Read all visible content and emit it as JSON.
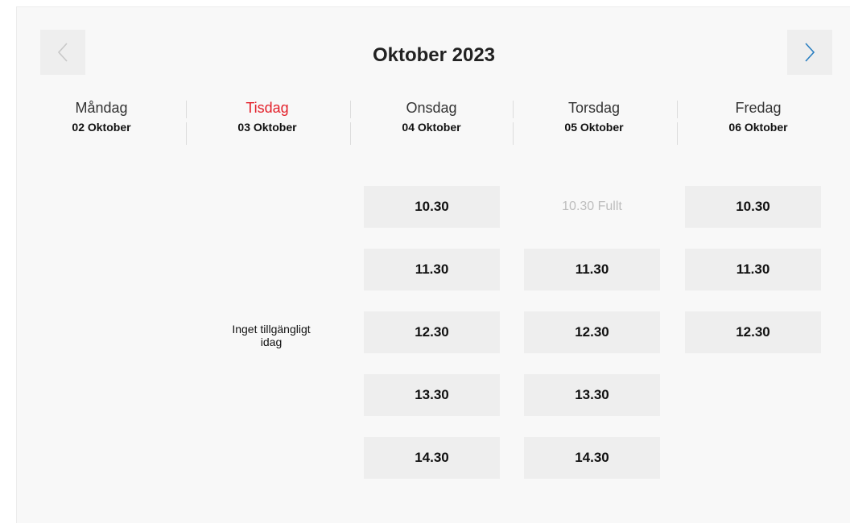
{
  "calendar": {
    "month_title": "Oktober 2023",
    "days": [
      {
        "name": "Måndag",
        "date": "02 Oktober",
        "today": false
      },
      {
        "name": "Tisdag",
        "date": "03 Oktober",
        "today": true
      },
      {
        "name": "Onsdag",
        "date": "04 Oktober",
        "today": false
      },
      {
        "name": "Torsdag",
        "date": "05 Oktober",
        "today": false
      },
      {
        "name": "Fredag",
        "date": "06 Oktober",
        "today": false
      }
    ],
    "unavailable_text": "Inget tillgängligt idag",
    "slots": {
      "onsdag": [
        "10.30",
        "11.30",
        "12.30",
        "13.30",
        "14.30"
      ],
      "torsdag": [
        "10.30 Fullt",
        "11.30",
        "12.30",
        "13.30",
        "14.30"
      ],
      "fredag": [
        "10.30",
        "11.30",
        "12.30"
      ]
    },
    "colors": {
      "today": "#e3202a",
      "next_arrow": "#2a7fc1",
      "prev_arrow": "#c8c8c8",
      "full_slot_text": "#bdbdbd"
    },
    "icons": {
      "prev": "chevron-left-icon",
      "next": "chevron-right-icon"
    }
  }
}
